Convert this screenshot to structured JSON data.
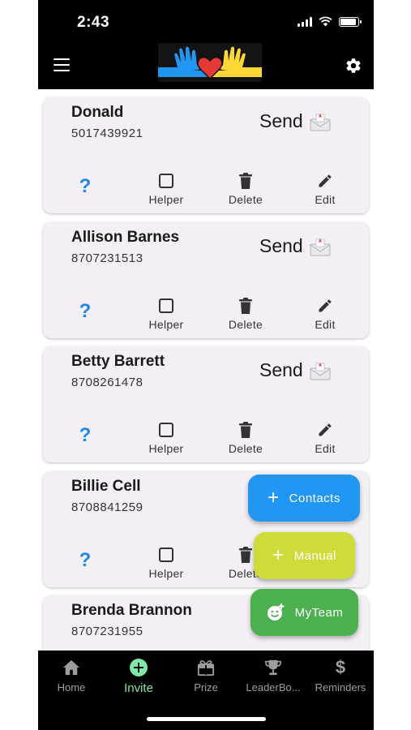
{
  "status": {
    "time": "2:43",
    "battery_level": 0.9
  },
  "appbar": {
    "menu_icon": "hamburger-menu-icon",
    "logo": "hands-heart-logo",
    "settings_icon": "gear-icon"
  },
  "card_actions": {
    "info": "?",
    "helper": "Helper",
    "delete": "Delete",
    "edit": "Edit",
    "send": "Send"
  },
  "contacts": [
    {
      "name": "Donald",
      "phone": "5017439921"
    },
    {
      "name": "Allison Barnes",
      "phone": "8707231513"
    },
    {
      "name": "Betty Barrett",
      "phone": "8708261478"
    },
    {
      "name": "Billie Cell",
      "phone": "8708841259"
    },
    {
      "name": "Brenda Brannon",
      "phone": "8707231955"
    }
  ],
  "fabs": {
    "contacts": {
      "label": "Contacts",
      "color": "#2196f3"
    },
    "manual": {
      "label": "Manual",
      "color": "#cddc39"
    },
    "myteam": {
      "label": "MyTeam",
      "color": "#4caf50"
    }
  },
  "nav": [
    {
      "label": "Home",
      "icon": "home-icon"
    },
    {
      "label": "Invite",
      "icon": "add-circle-icon",
      "active": true
    },
    {
      "label": "Prize",
      "icon": "gift-icon"
    },
    {
      "label": "LeaderBo...",
      "icon": "trophy-icon"
    },
    {
      "label": "Reminders",
      "icon": "dollar-icon"
    }
  ],
  "colors": {
    "accent": "#1e88e5",
    "active_tab": "#7ee8a6",
    "card_bg": "#f4eff5"
  }
}
